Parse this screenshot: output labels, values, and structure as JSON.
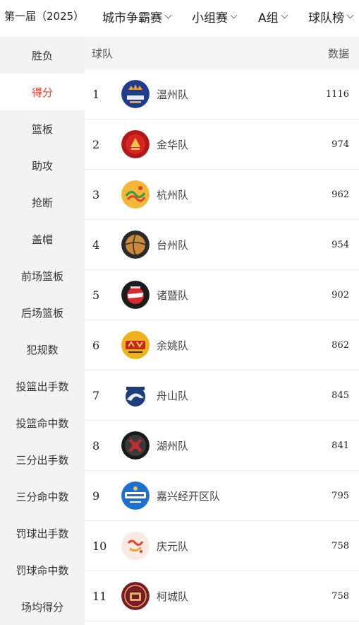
{
  "header": {
    "season": "第一届（2025）",
    "filters": [
      {
        "label": "城市争霸赛"
      },
      {
        "label": "小组赛"
      },
      {
        "label": "A组"
      },
      {
        "label": "球队榜"
      }
    ]
  },
  "sidebar": {
    "items": [
      {
        "label": "胜负"
      },
      {
        "label": "得分"
      },
      {
        "label": "篮板"
      },
      {
        "label": "助攻"
      },
      {
        "label": "抢断"
      },
      {
        "label": "盖帽"
      },
      {
        "label": "前场篮板"
      },
      {
        "label": "后场篮板"
      },
      {
        "label": "犯规数"
      },
      {
        "label": "投篮出手数"
      },
      {
        "label": "投篮命中数"
      },
      {
        "label": "三分出手数"
      },
      {
        "label": "三分命中数"
      },
      {
        "label": "罚球出手数"
      },
      {
        "label": "罚球命中数"
      },
      {
        "label": "场均得分"
      }
    ],
    "active": "得分"
  },
  "table": {
    "col_team": "球队",
    "col_value": "数据",
    "rows": [
      {
        "rank": "1",
        "team": "温州队",
        "value": "1116",
        "logo_icon": "wenzhou-logo-icon"
      },
      {
        "rank": "2",
        "team": "金华队",
        "value": "974",
        "logo_icon": "jinhua-logo-icon"
      },
      {
        "rank": "3",
        "team": "杭州队",
        "value": "962",
        "logo_icon": "hangzhou-logo-icon"
      },
      {
        "rank": "4",
        "team": "台州队",
        "value": "954",
        "logo_icon": "taizhou-logo-icon"
      },
      {
        "rank": "5",
        "team": "诸暨队",
        "value": "902",
        "logo_icon": "zhuji-logo-icon"
      },
      {
        "rank": "6",
        "team": "余姚队",
        "value": "862",
        "logo_icon": "yuyao-logo-icon"
      },
      {
        "rank": "7",
        "team": "舟山队",
        "value": "845",
        "logo_icon": "zhoushan-logo-icon"
      },
      {
        "rank": "8",
        "team": "湖州队",
        "value": "841",
        "logo_icon": "huzhou-logo-icon"
      },
      {
        "rank": "9",
        "team": "嘉兴经开区队",
        "value": "795",
        "logo_icon": "jiaxing-logo-icon"
      },
      {
        "rank": "10",
        "team": "庆元队",
        "value": "758",
        "logo_icon": "qingyuan-logo-icon"
      },
      {
        "rank": "11",
        "team": "柯城队",
        "value": "758",
        "logo_icon": "kecheng-logo-icon"
      }
    ]
  },
  "colors": {
    "accent": "#e8412c",
    "sidebar_bg": "#f3f3f3",
    "header_bg": "#f5f5f5"
  }
}
